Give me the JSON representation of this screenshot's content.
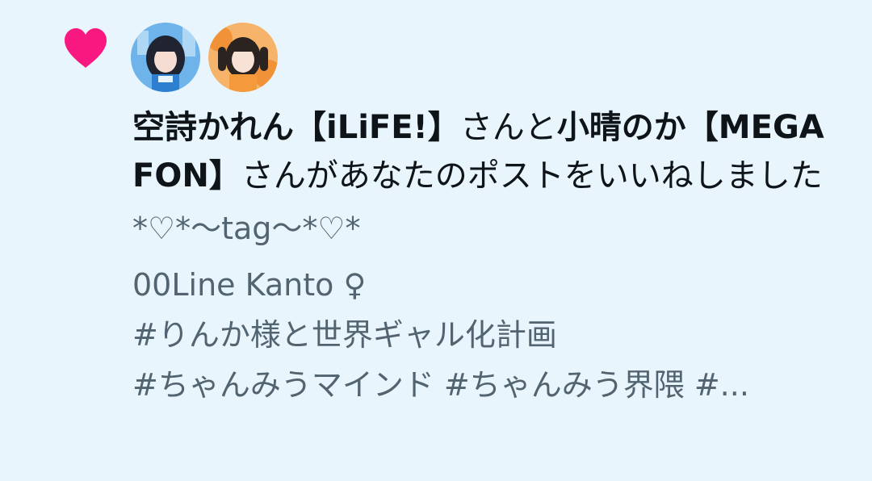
{
  "notification": {
    "icon": "heart-icon",
    "icon_color": "#f91880",
    "avatars": [
      {
        "name": "avatar-user-1",
        "accent": "#5aa8e8"
      },
      {
        "name": "avatar-user-2",
        "accent": "#f08a2c"
      }
    ],
    "message": {
      "user1": "空詩かれん【iLiFE!】",
      "and": "さんと",
      "user2": "小晴のか【MEGAFON】",
      "action": "さんがあなたのポストをいいねしました"
    },
    "post_preview": {
      "line1": "*♡*〜tag〜*♡*",
      "line2": "00Line  Kanto ♀",
      "line3": "#りんか様と世界ギャル化計画",
      "line4": "#ちゃんみうマインド #ちゃんみう界隈 #..."
    }
  },
  "colors": {
    "background": "#e8f5fd",
    "text_primary": "#0f1419",
    "text_secondary": "#536471"
  }
}
